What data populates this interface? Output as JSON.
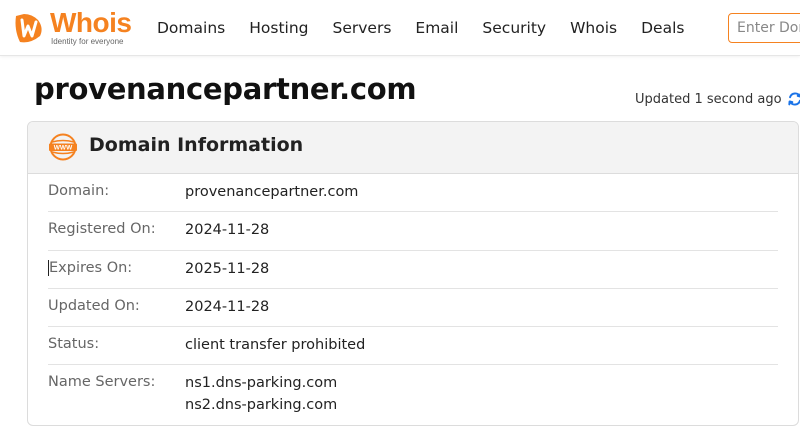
{
  "header": {
    "logo_text": "Whois",
    "logo_tagline": "Identity for everyone",
    "nav": [
      "Domains",
      "Hosting",
      "Servers",
      "Email",
      "Security",
      "Whois",
      "Deals"
    ],
    "search_placeholder": "Enter Domain or IP"
  },
  "page": {
    "title": "provenancepartner.com",
    "updated_text": "Updated 1 second ago"
  },
  "card": {
    "title": "Domain Information",
    "rows": [
      {
        "label": "Domain:",
        "value": "provenancepartner.com"
      },
      {
        "label": "Registered On:",
        "value": "2024-11-28"
      },
      {
        "label": "Expires On:",
        "value": "2025-11-28"
      },
      {
        "label": "Updated On:",
        "value": "2024-11-28"
      },
      {
        "label": "Status:",
        "value": "client transfer prohibited"
      },
      {
        "label": "Name Servers:",
        "values": [
          "ns1.dns-parking.com",
          "ns2.dns-parking.com"
        ]
      }
    ]
  },
  "colors": {
    "brand_orange": "#f58220",
    "refresh_blue": "#1a73e8"
  },
  "icons": {
    "logo": "whois-logo-icon",
    "refresh": "refresh-icon",
    "card": "www-globe-icon"
  }
}
